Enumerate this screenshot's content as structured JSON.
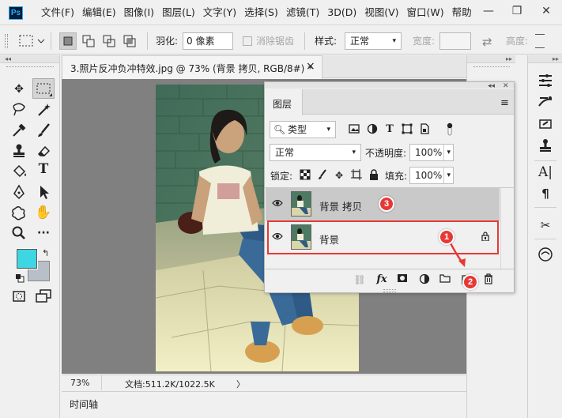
{
  "app": {
    "logo": "Ps",
    "menu": [
      "文件(F)",
      "编辑(E)",
      "图像(I)",
      "图层(L)",
      "文字(Y)",
      "选择(S)",
      "滤镜(T)",
      "3D(D)",
      "视图(V)",
      "窗口(W)",
      "帮助"
    ],
    "window_controls": [
      "—",
      "❐",
      "✕"
    ]
  },
  "options": {
    "feather_label": "羽化:",
    "feather_value": "0 像素",
    "antialias_label": "消除锯齿",
    "style_label": "样式:",
    "style_value": "正常",
    "width_label": "宽度:",
    "height_label": "高度:"
  },
  "document": {
    "tab_title": "3.照片反冲负冲特效.jpg @ 73% (背景 拷贝, RGB/8#) *",
    "tab_close": "×",
    "zoom": "73%",
    "doc_info": "文档:511.2K/1022.5K",
    "status_arrow": "〉",
    "timeline_label": "时间轴"
  },
  "colors": {
    "foreground": "#3fd6e3",
    "background": "#b9bfc8",
    "highlight_box": "#e53935",
    "badge": "#e53935"
  },
  "layers_panel": {
    "title": "图层",
    "filter_value": "类型",
    "blend_mode": "正常",
    "opacity_label": "不透明度:",
    "opacity_value": "100%",
    "lock_label": "锁定:",
    "fill_label": "填充:",
    "fill_value": "100%",
    "layers": [
      {
        "name": "背景 拷贝",
        "visible": true,
        "selected": true,
        "locked": false
      },
      {
        "name": "背景",
        "visible": true,
        "selected": false,
        "locked": true
      }
    ],
    "footer_icons": [
      "link-icon",
      "fx-icon",
      "mask-icon",
      "adjustment-icon",
      "folder-icon",
      "new-layer-icon",
      "trash-icon"
    ],
    "fx_label": "fx"
  },
  "annotations": {
    "badge1": "1",
    "badge2": "2",
    "badge3": "3"
  }
}
